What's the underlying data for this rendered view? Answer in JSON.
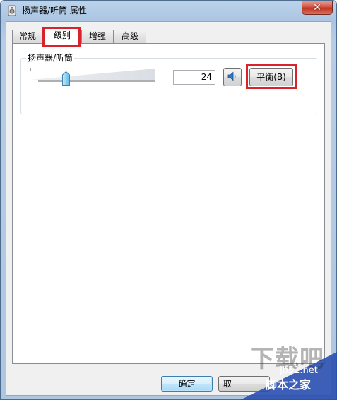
{
  "window": {
    "title": "扬声器/听筒 属性",
    "close_label": "✕"
  },
  "tabs": [
    {
      "label": "常规",
      "active": false
    },
    {
      "label": "级别",
      "active": true
    },
    {
      "label": "增强",
      "active": false
    },
    {
      "label": "高级",
      "active": false
    }
  ],
  "levels": {
    "group_label": "扬声器/听筒",
    "level_value": "24",
    "slider_fraction": 0.24,
    "volume_icon": "speaker-icon",
    "balance_label": "平衡(B)"
  },
  "buttons": {
    "ok_label": "确定",
    "cancel_label": "取"
  },
  "highlight_color": "#d8232a",
  "watermark": {
    "brand": "下载吧",
    "url": "jb51.net",
    "name": "脚本之家"
  }
}
